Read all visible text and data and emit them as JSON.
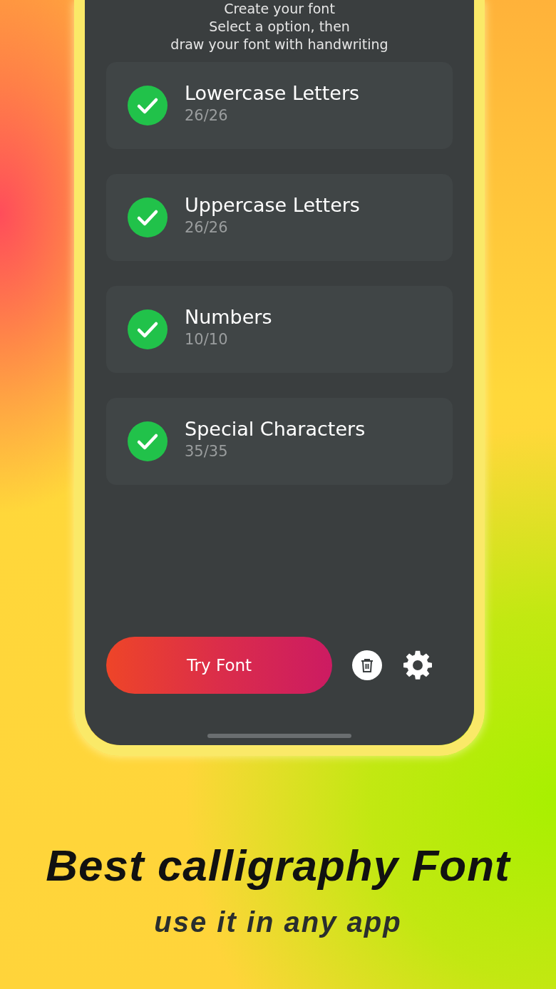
{
  "header": {
    "lines": [
      "Create your font",
      "Select a option, then",
      "draw your font with handwriting"
    ]
  },
  "categories": [
    {
      "title": "Lowercase Letters",
      "count": "26/26",
      "completed": true
    },
    {
      "title": "Uppercase Letters",
      "count": "26/26",
      "completed": true
    },
    {
      "title": "Numbers",
      "count": "10/10",
      "completed": true
    },
    {
      "title": "Special Characters",
      "count": "35/35",
      "completed": true
    }
  ],
  "actions": {
    "primary": "Try Font"
  },
  "promo": {
    "headline": "Best calligraphy Font",
    "subline": "use it in any app"
  }
}
